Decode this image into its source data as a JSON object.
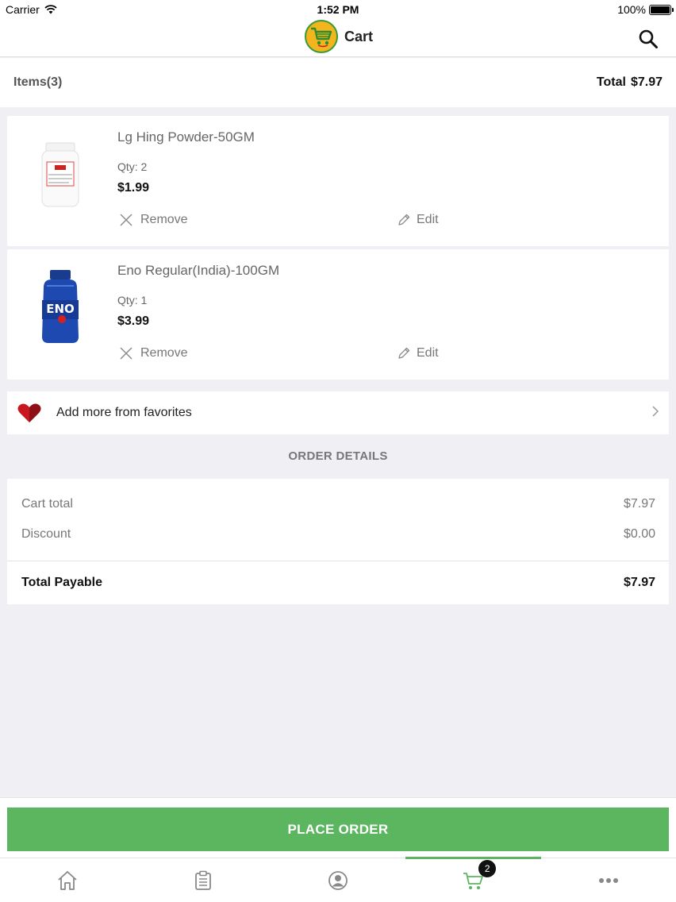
{
  "status_bar": {
    "carrier": "Carrier",
    "time": "1:52 PM",
    "battery": "100%"
  },
  "nav": {
    "title": "Cart"
  },
  "cart_header": {
    "items_label": "Items(3)",
    "total_label": "Total",
    "total_value": "$7.97"
  },
  "items": [
    {
      "name": "Lg Hing Powder-50GM",
      "qty": "Qty: 2",
      "price": "$1.99",
      "remove_label": "Remove",
      "edit_label": "Edit"
    },
    {
      "name": "Eno Regular(India)-100GM",
      "qty": "Qty: 1",
      "price": "$3.99",
      "remove_label": "Remove",
      "edit_label": "Edit"
    }
  ],
  "favorites": {
    "label": "Add more from favorites"
  },
  "order_details": {
    "title": "ORDER DETAILS",
    "cart_total_label": "Cart total",
    "cart_total_value": "$7.97",
    "discount_label": "Discount",
    "discount_value": "$0.00",
    "total_payable_label": "Total Payable",
    "total_payable_value": "$7.97"
  },
  "place_order": {
    "label": "PLACE ORDER"
  },
  "tab_bar": {
    "tabs": [
      {
        "icon": "home-icon"
      },
      {
        "icon": "orders-icon"
      },
      {
        "icon": "profile-icon"
      },
      {
        "icon": "cart-icon",
        "badge": "2",
        "active": true
      },
      {
        "icon": "more-icon"
      }
    ]
  },
  "colors": {
    "accent": "#5cb660",
    "heart": "#c8171e",
    "logo_bg": "#f2b51d"
  }
}
